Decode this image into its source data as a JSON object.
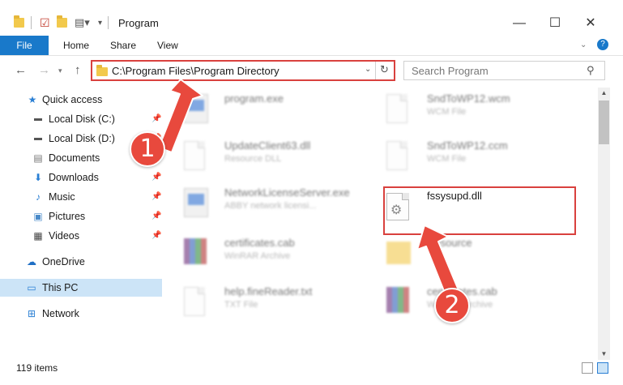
{
  "window": {
    "title": "Program"
  },
  "ribbon": {
    "tabs": [
      "File",
      "Home",
      "Share",
      "View"
    ]
  },
  "address": {
    "path": "C:\\Program Files\\Program Directory"
  },
  "search": {
    "placeholder": "Search Program"
  },
  "sidebar": {
    "items": [
      {
        "label": "Quick access",
        "icon": "star-icon",
        "pinned": false
      },
      {
        "label": "Local Disk (C:)",
        "icon": "drive-icon",
        "pinned": true
      },
      {
        "label": "Local Disk (D:)",
        "icon": "drive-icon",
        "pinned": true
      },
      {
        "label": "Documents",
        "icon": "documents-icon",
        "pinned": true
      },
      {
        "label": "Downloads",
        "icon": "download-icon",
        "pinned": true
      },
      {
        "label": "Music",
        "icon": "music-icon",
        "pinned": true
      },
      {
        "label": "Pictures",
        "icon": "pictures-icon",
        "pinned": true
      },
      {
        "label": "Videos",
        "icon": "videos-icon",
        "pinned": true
      },
      {
        "label": "OneDrive",
        "icon": "cloud-icon",
        "pinned": false
      },
      {
        "label": "This PC",
        "icon": "computer-icon",
        "pinned": false
      },
      {
        "label": "Network",
        "icon": "network-icon",
        "pinned": false
      }
    ]
  },
  "files": [
    {
      "name": "program.exe",
      "type": "",
      "kind": "exe"
    },
    {
      "name": "SndToWP12.wcm",
      "type": "WCM File",
      "kind": "doc"
    },
    {
      "name": "UpdateClient63.dll",
      "type": "Resource DLL",
      "kind": "dll"
    },
    {
      "name": "SndToWP12.ccm",
      "type": "WCM File",
      "kind": "doc"
    },
    {
      "name": "NetworkLicenseServer.exe",
      "type": "ABBY network licensi...",
      "kind": "exe"
    },
    {
      "name": "fssysupd.dll",
      "type": "",
      "kind": "dll"
    },
    {
      "name": "certificates.cab",
      "type": "WinRAR Archive",
      "kind": "cab"
    },
    {
      "name": "Resource",
      "type": "",
      "kind": "folder"
    },
    {
      "name": "help.fineReader.txt",
      "type": "TXT File",
      "kind": "doc"
    },
    {
      "name": "certificates.cab",
      "type": "WinRAR Archive",
      "kind": "cab"
    }
  ],
  "status": {
    "count": "119 items"
  },
  "annotations": {
    "step1": "1",
    "step2": "2"
  }
}
